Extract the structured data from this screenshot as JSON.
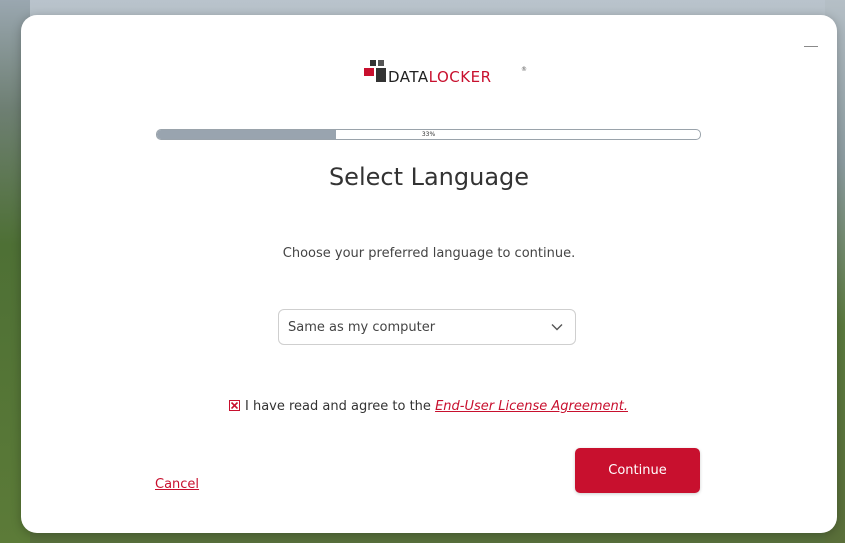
{
  "brand": {
    "name_prefix": "DATA",
    "name_suffix": "LOCKER",
    "registered": "®",
    "accent_color": "#c8102e"
  },
  "window": {
    "minimize_icon": "minimize-icon"
  },
  "progress": {
    "percent": 33,
    "label": "33%"
  },
  "content": {
    "title": "Select Language",
    "subtitle": "Choose your preferred language to continue."
  },
  "language_select": {
    "selected": "Same as my computer",
    "icon": "chevron-down-icon"
  },
  "agreement": {
    "checked": true,
    "text": "I have read and agree to the ",
    "link_text": "End-User License Agreement."
  },
  "actions": {
    "cancel_label": "Cancel",
    "continue_label": "Continue"
  }
}
